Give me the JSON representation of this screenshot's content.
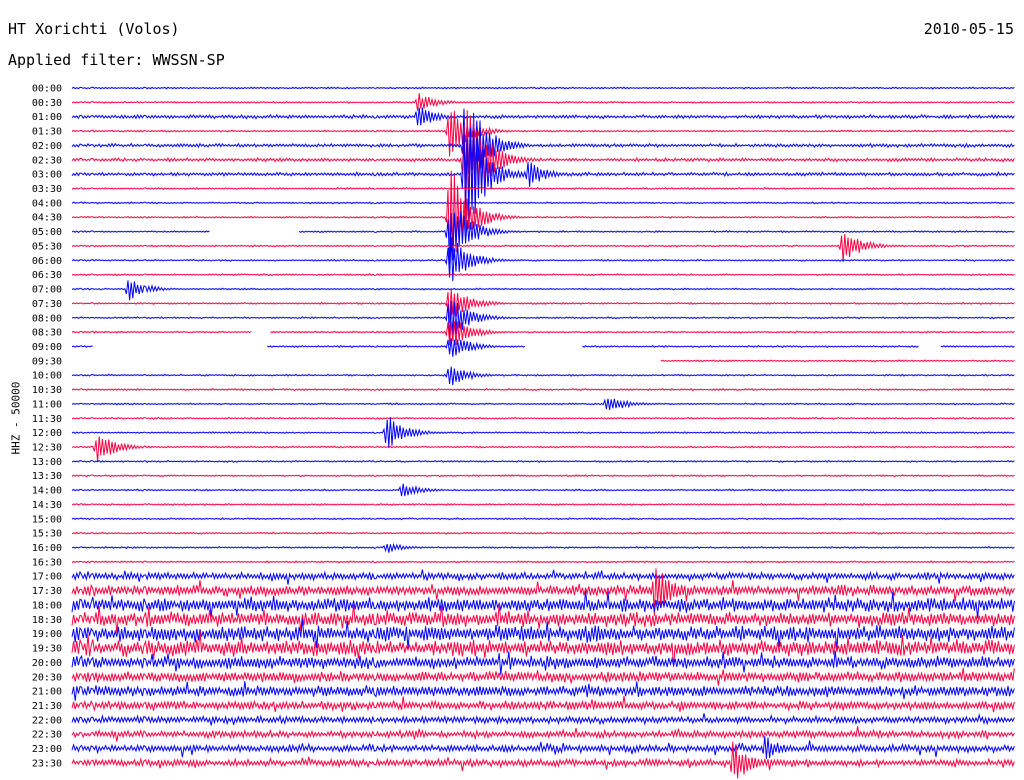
{
  "header": {
    "station": "HT Xorichti (Volos)",
    "filter": "Applied filter: WWSSN-SP",
    "date": "2010-05-15",
    "channel": "HHZ - 50000"
  },
  "colors": {
    "trace_a": "#0000ff",
    "trace_b": "#ff0040",
    "background": "#ffffff",
    "text": "#000000"
  },
  "chart_data": {
    "type": "line",
    "description_type": "helicorder",
    "title": "HT Xorichti (Volos)",
    "subtitle": "Applied filter: WWSSN-SP",
    "ylabel": "HHZ - 50000",
    "xlabel": "",
    "row_labels": [
      "00:00",
      "00:30",
      "01:00",
      "01:30",
      "02:00",
      "02:30",
      "03:00",
      "03:30",
      "04:00",
      "04:30",
      "05:00",
      "05:30",
      "06:00",
      "06:30",
      "07:00",
      "07:30",
      "08:00",
      "08:30",
      "09:00",
      "09:30",
      "10:00",
      "10:30",
      "11:00",
      "11:30",
      "12:00",
      "12:30",
      "13:00",
      "13:30",
      "14:00",
      "14:30",
      "15:00",
      "15:30",
      "16:00",
      "16:30",
      "17:00",
      "17:30",
      "18:00",
      "18:30",
      "19:00",
      "19:30",
      "20:00",
      "20:30",
      "21:00",
      "21:30",
      "22:00",
      "22:30",
      "23:00",
      "23:30"
    ],
    "row_minutes": 30,
    "row_colors_alternate": [
      "#0000ff",
      "#ff0040"
    ],
    "noise_level": [
      1,
      1,
      2,
      1,
      2,
      2,
      2,
      1,
      1,
      1,
      1,
      1,
      1,
      1,
      1,
      1,
      1,
      1,
      1,
      1,
      1,
      1,
      1,
      1,
      1,
      1,
      1,
      1,
      1,
      1,
      1,
      1,
      1,
      1,
      4,
      6,
      8,
      8,
      9,
      9,
      7,
      6,
      6,
      5,
      4,
      4,
      4,
      4
    ],
    "events": [
      {
        "row": 1,
        "minute": 11,
        "amplitude": 10
      },
      {
        "row": 2,
        "minute": 11,
        "amplitude": 12
      },
      {
        "row": 3,
        "minute": 12,
        "amplitude": 30
      },
      {
        "row": 4,
        "minute": 12.5,
        "amplitude": 60
      },
      {
        "row": 5,
        "minute": 12.5,
        "amplitude": 80
      },
      {
        "row": 6,
        "minute": 12.5,
        "amplitude": 70
      },
      {
        "row": 6,
        "minute": 14.5,
        "amplitude": 14
      },
      {
        "row": 9,
        "minute": 12,
        "amplitude": 60
      },
      {
        "row": 10,
        "minute": 12,
        "amplitude": 40
      },
      {
        "row": 11,
        "minute": 24.5,
        "amplitude": 18
      },
      {
        "row": 12,
        "minute": 12,
        "amplitude": 30
      },
      {
        "row": 14,
        "minute": 1.8,
        "amplitude": 12
      },
      {
        "row": 15,
        "minute": 12,
        "amplitude": 20
      },
      {
        "row": 16,
        "minute": 12,
        "amplitude": 25
      },
      {
        "row": 17,
        "minute": 12,
        "amplitude": 20
      },
      {
        "row": 18,
        "minute": 12,
        "amplitude": 15
      },
      {
        "row": 20,
        "minute": 12,
        "amplitude": 12
      },
      {
        "row": 22,
        "minute": 17,
        "amplitude": 10
      },
      {
        "row": 24,
        "minute": 10,
        "amplitude": 20
      },
      {
        "row": 25,
        "minute": 0.8,
        "amplitude": 16
      },
      {
        "row": 28,
        "minute": 10.5,
        "amplitude": 8
      },
      {
        "row": 32,
        "minute": 10,
        "amplitude": 6
      },
      {
        "row": 35,
        "minute": 18.5,
        "amplitude": 28
      },
      {
        "row": 46,
        "minute": 22,
        "amplitude": 14
      },
      {
        "row": 47,
        "minute": 21,
        "amplitude": 22
      }
    ],
    "gaps": [
      {
        "row": 10,
        "from_minute": 4.4,
        "to_minute": 7.2
      },
      {
        "row": 17,
        "from_minute": 5.7,
        "to_minute": 6.3
      },
      {
        "row": 18,
        "from_minute": 0.7,
        "to_minute": 6.2
      },
      {
        "row": 18,
        "from_minute": 14.4,
        "to_minute": 16.2
      },
      {
        "row": 18,
        "from_minute": 26.9,
        "to_minute": 27.6
      },
      {
        "row": 19,
        "from_minute": 0,
        "to_minute": 18.7
      }
    ],
    "grid": false,
    "legend": "none"
  }
}
